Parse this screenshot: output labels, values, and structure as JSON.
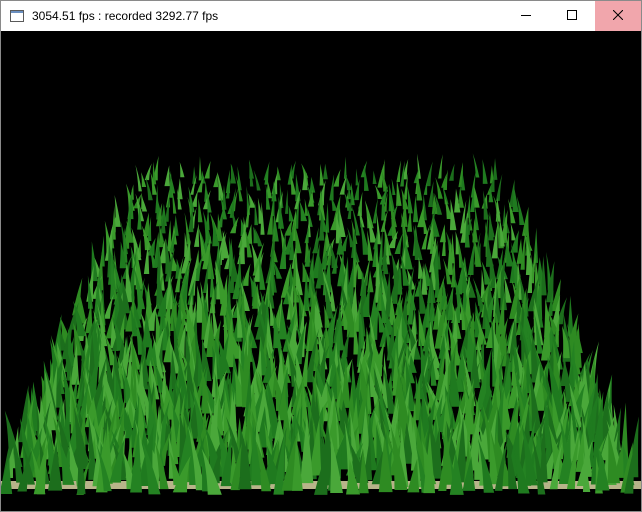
{
  "window": {
    "title": "3054.51 fps : recorded 3292.77 fps",
    "icon": "app-window-icon",
    "controls": {
      "minimize": "minimize-icon",
      "maximize": "maximize-icon",
      "close": "close-icon"
    },
    "close_hover_color": "#f1a6ac"
  },
  "scene": {
    "background_color": "#000000",
    "grass_colors": [
      "#1f7a1f",
      "#2e8b22",
      "#3a9a2b",
      "#248222",
      "#4aa83a",
      "#1c6e1c"
    ],
    "ground_color": "#b8b48a"
  }
}
